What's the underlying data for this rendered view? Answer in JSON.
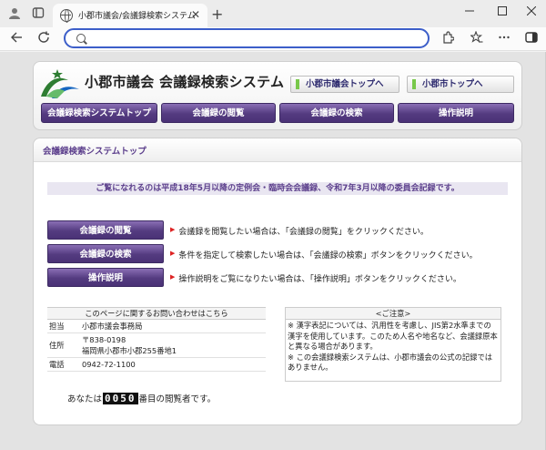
{
  "browser": {
    "tab_title": "小郡市議会/会議録検索システム",
    "tab_close": "✕",
    "new_tab": "+",
    "address_value": "",
    "address_placeholder": ""
  },
  "header": {
    "site_title": "小郡市議会 会議録検索システム",
    "ext_links": [
      "小郡市議会トップへ",
      "小郡市トップへ"
    ],
    "nav": [
      "会議録検索システムトップ",
      "会議録の閲覧",
      "会議録の検索",
      "操作説明"
    ]
  },
  "content": {
    "title": "会議録検索システムトップ",
    "notice": "ご覧になれるのは平成18年5月以降の定例会・臨時会会議録、令和7年3月以降の委員会記録です。",
    "actions": [
      {
        "label": "会議録の閲覧",
        "desc": "会議録を閲覧したい場合は、「会議録の閲覧」をクリックください。"
      },
      {
        "label": "会議録の検索",
        "desc": "条件を指定して検索したい場合は、「会議録の検索」ボタンをクリックください。"
      },
      {
        "label": "操作説明",
        "desc": "操作説明をご覧になりたい場合は、「操作説明」ボタンをクリックください。"
      }
    ],
    "contact": {
      "title": "このページに関するお問い合わせはこちら",
      "rows": [
        {
          "label": "担当",
          "value": "小郡市議会事務局"
        },
        {
          "label": "住所",
          "value": "〒838-0198",
          "value2": "福岡県小郡市小郡255番地1"
        },
        {
          "label": "電話",
          "value": "0942-72-1100"
        }
      ]
    },
    "caution": {
      "title": "<ご注意>",
      "line1": "※ 漢字表記については、汎用性を考慮し、JIS第2水準までの漢字を使用しています。このため人名や地名など、会議録原本と異なる場合があります。",
      "line2": "※ この会議録検索システムは、小郡市議会の公式の記録ではありません。"
    },
    "counter": {
      "prefix": "あなたは",
      "digits": "0050",
      "suffix": "番目の閲覧者です。"
    }
  },
  "colors": {
    "accent": "#543b80",
    "title_purple": "#5c3f8c",
    "address_border": "#3c5ec9"
  }
}
